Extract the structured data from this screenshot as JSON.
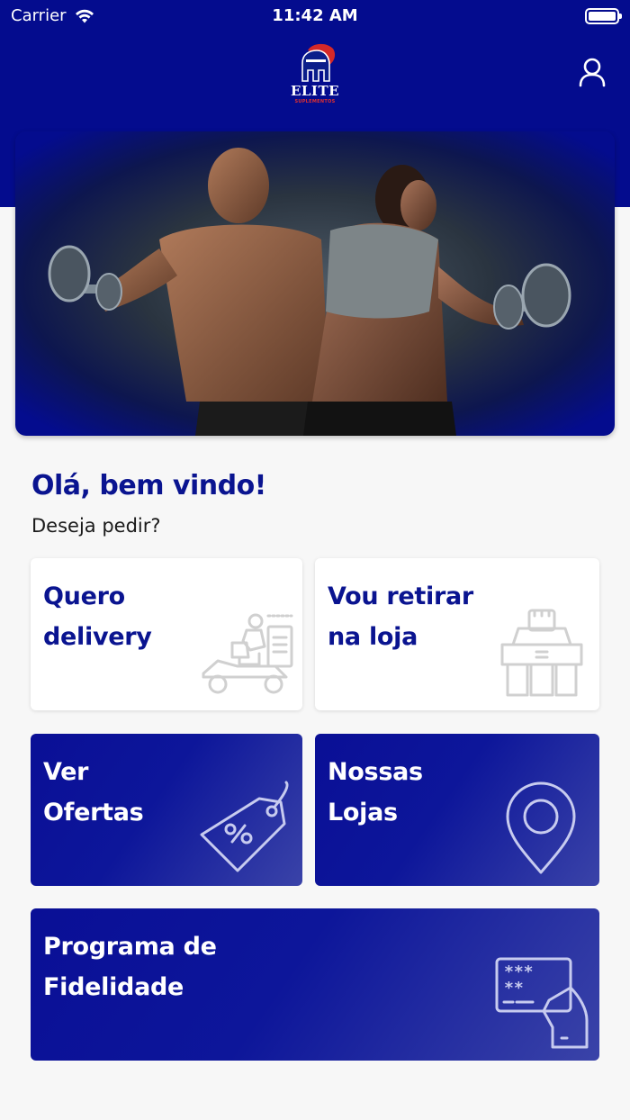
{
  "status_bar": {
    "carrier": "Carrier",
    "time": "11:42 AM"
  },
  "brand": {
    "logo_text": "ELITE",
    "logo_subtext": "SUPLEMENTOS",
    "primary_color": "#040c8e",
    "accent_color": "#e03030"
  },
  "header": {
    "profile_icon": "user-icon"
  },
  "welcome": {
    "title": "Olá, bem vindo!",
    "subtitle": "Deseja pedir?"
  },
  "cards": {
    "delivery": {
      "line1": "Quero",
      "line2": "delivery",
      "icon": "delivery-scooter-icon"
    },
    "pickup": {
      "line1": "Vou retirar",
      "line2": "na loja",
      "icon": "store-pickup-icon"
    },
    "offers": {
      "line1": "Ver",
      "line2": "Ofertas",
      "icon": "discount-tag-icon"
    },
    "stores": {
      "line1": "Nossas",
      "line2": "Lojas",
      "icon": "location-pin-icon"
    },
    "loyalty": {
      "line1": "Programa de",
      "line2": "Fidelidade",
      "icon": "loyalty-card-icon"
    }
  }
}
